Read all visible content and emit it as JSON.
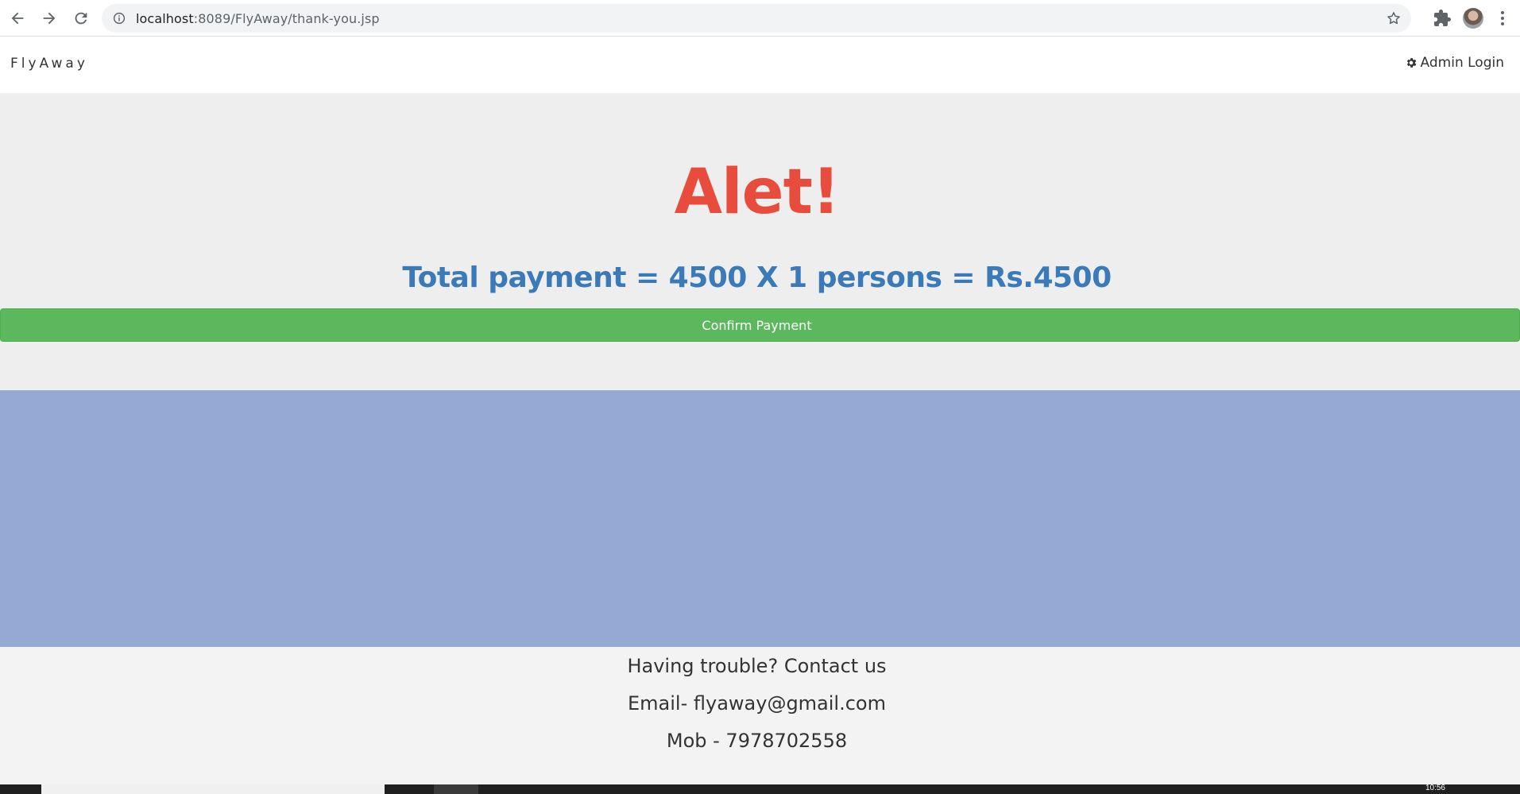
{
  "browser": {
    "url_host": "localhost",
    "url_rest": ":8089/FlyAway/thank-you.jsp"
  },
  "navbar": {
    "brand": "FlyAway",
    "admin_login": "Admin Login"
  },
  "hero": {
    "title": "Alet!",
    "payment_text": "Total payment = 4500 X 1 persons = Rs.4500",
    "confirm_button": "Confirm Payment"
  },
  "footer": {
    "line1": "Having trouble? Contact us",
    "line2": "Email- flyaway@gmail.com",
    "line3": "Mob - 7978702558"
  },
  "taskbar": {
    "clock": "10:56"
  },
  "colors": {
    "alert_red": "#e74c3c",
    "payment_blue": "#3b7ab8",
    "confirm_green": "#5cb85c",
    "band_blue": "#94a9d3",
    "hero_bg": "#eeeeee",
    "footer_bg": "#f3f3f3"
  },
  "icons": [
    "back-arrow-icon",
    "forward-arrow-icon",
    "reload-icon",
    "info-icon",
    "star-icon",
    "puzzle-icon",
    "kebab-menu-icon",
    "gear-icon"
  ]
}
